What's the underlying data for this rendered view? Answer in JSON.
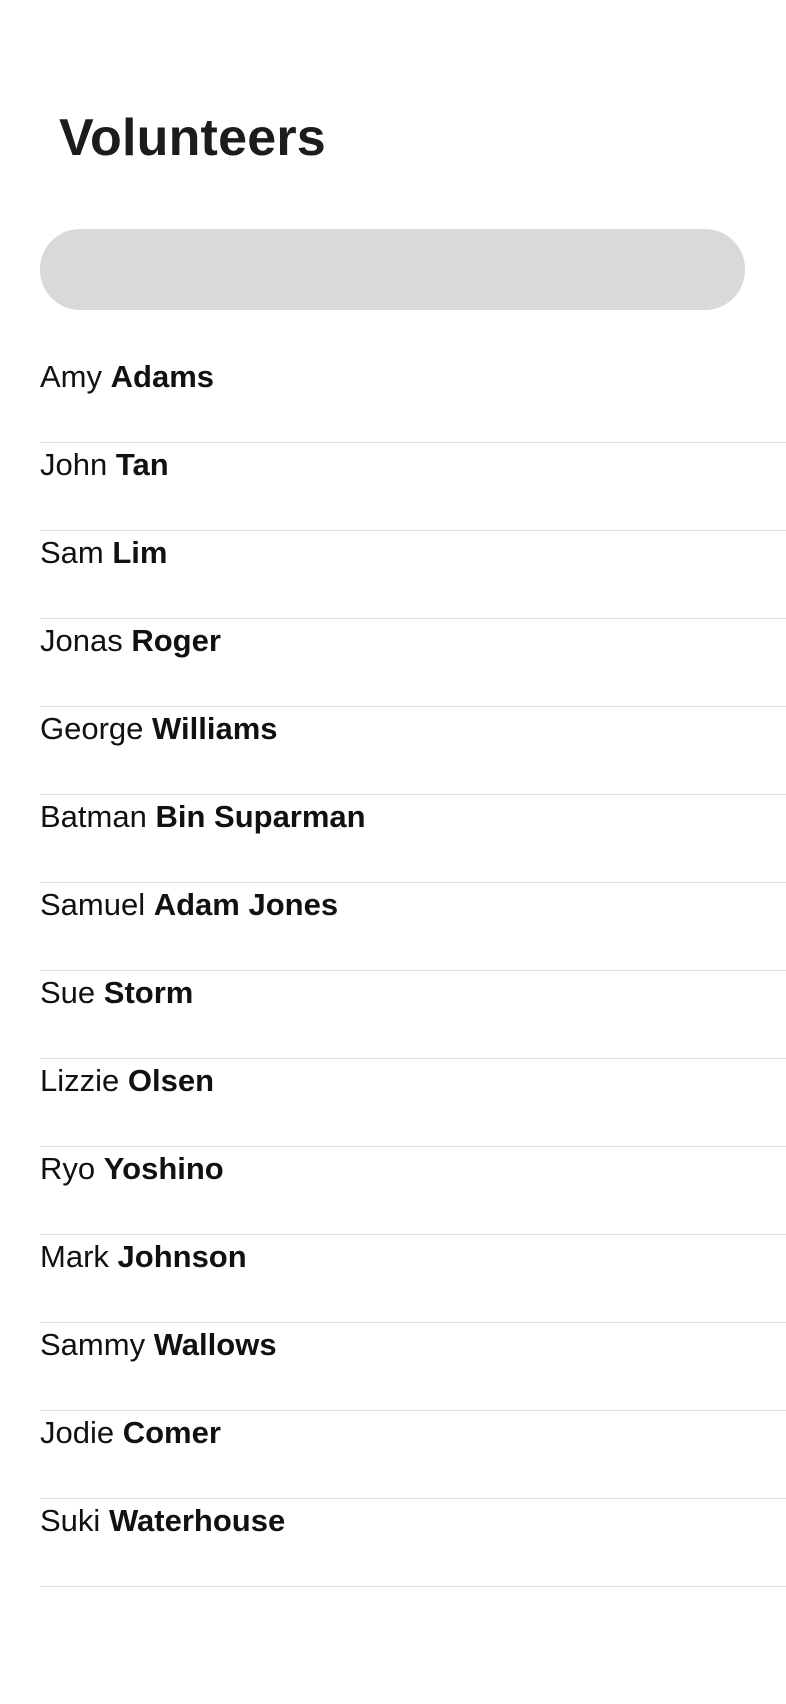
{
  "header": {
    "title": "Volunteers"
  },
  "search": {
    "placeholder": "",
    "value": ""
  },
  "volunteers": [
    {
      "first": "Amy",
      "last": "Adams"
    },
    {
      "first": "John",
      "last": "Tan"
    },
    {
      "first": "Sam",
      "last": "Lim"
    },
    {
      "first": "Jonas",
      "last": "Roger"
    },
    {
      "first": "George",
      "last": "Williams"
    },
    {
      "first": "Batman",
      "last": "Bin Suparman"
    },
    {
      "first": "Samuel",
      "last": "Adam Jones"
    },
    {
      "first": "Sue",
      "last": "Storm"
    },
    {
      "first": "Lizzie",
      "last": "Olsen"
    },
    {
      "first": "Ryo",
      "last": "Yoshino"
    },
    {
      "first": "Mark",
      "last": "Johnson"
    },
    {
      "first": "Sammy",
      "last": "Wallows"
    },
    {
      "first": "Jodie",
      "last": "Comer"
    },
    {
      "first": "Suki",
      "last": "Waterhouse"
    }
  ],
  "colors": {
    "background": "#ffffff",
    "search_fill": "#d9d9d9",
    "divider": "#dcdcdc",
    "text": "#111111"
  }
}
